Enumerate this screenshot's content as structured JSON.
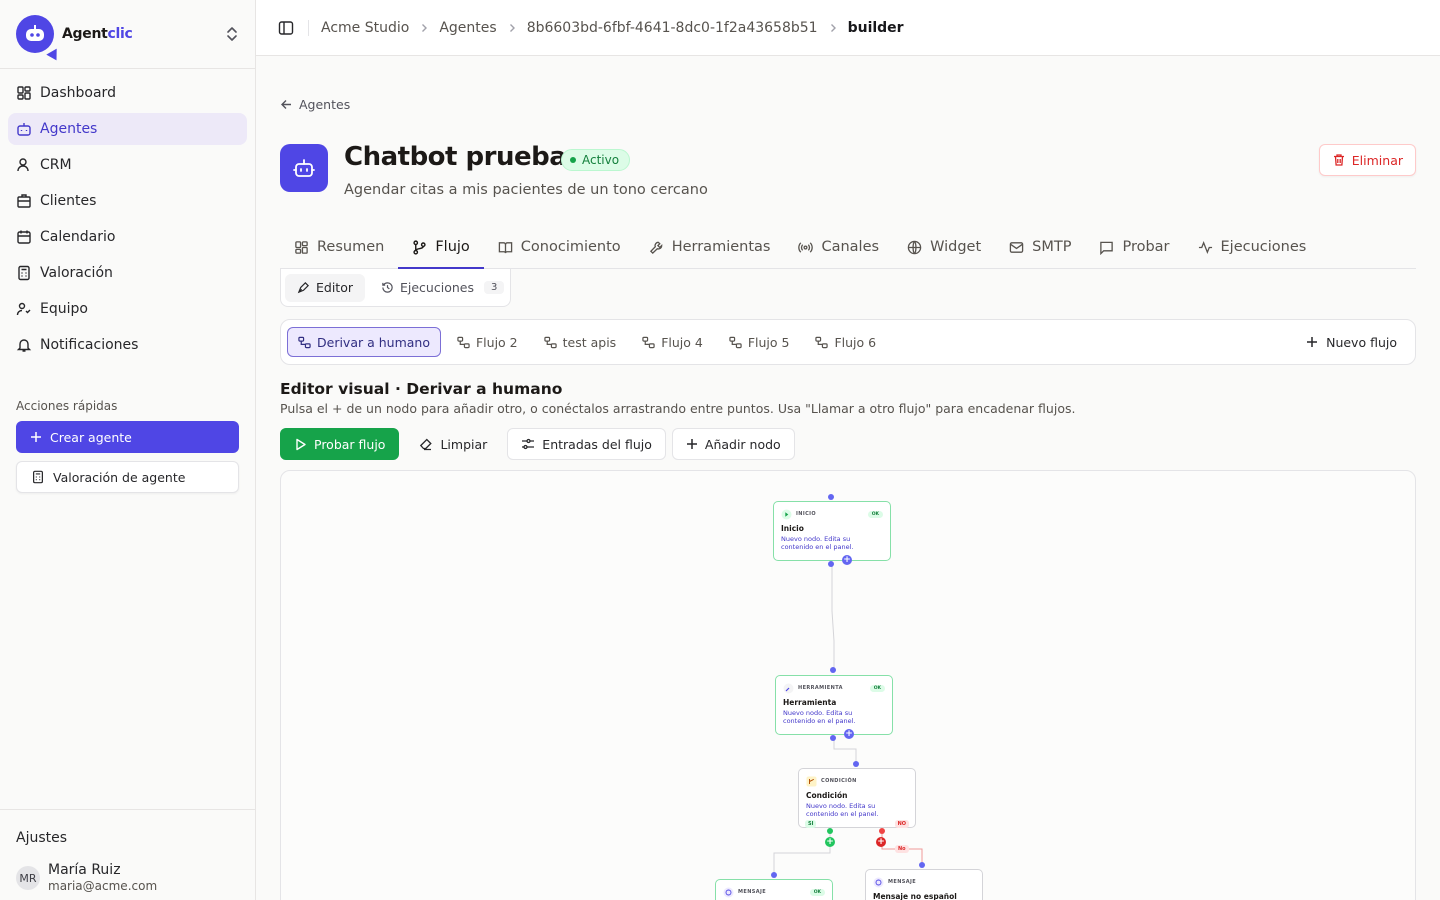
{
  "brand": {
    "name_main": "Agent",
    "name_accent": "clic"
  },
  "sidebar": {
    "items": [
      {
        "label": "Dashboard",
        "icon": "dashboard-icon"
      },
      {
        "label": "Agentes",
        "icon": "bot-icon",
        "active": true
      },
      {
        "label": "CRM",
        "icon": "users-icon"
      },
      {
        "label": "Clientes",
        "icon": "building-icon"
      },
      {
        "label": "Calendario",
        "icon": "calendar-icon"
      },
      {
        "label": "Valoración",
        "icon": "calculator-icon"
      },
      {
        "label": "Equipo",
        "icon": "team-icon"
      },
      {
        "label": "Notificaciones",
        "icon": "bell-icon"
      }
    ],
    "quick_actions_title": "Acciones rápidas",
    "quick_primary": "Crear agente",
    "quick_secondary": "Valoración de agente",
    "settings": "Ajustes",
    "user": {
      "initials": "MR",
      "name": "María Ruiz",
      "email": "maria@acme.com"
    }
  },
  "breadcrumb": [
    "Acme Studio",
    "Agentes",
    "8b6603bd-6fbf-4641-8dc0-1f2a43658b51",
    "builder"
  ],
  "back_label": "Agentes",
  "agent": {
    "title": "Chatbot pruebas",
    "status": "Activo",
    "subtitle": "Agendar citas a mis pacientes de un tono cercano",
    "delete": "Eliminar"
  },
  "tabs": [
    "Resumen",
    "Flujo",
    "Conocimiento",
    "Herramientas",
    "Canales",
    "Widget",
    "SMTP",
    "Probar",
    "Ejecuciones"
  ],
  "subtabs": {
    "editor": "Editor",
    "runs": "Ejecuciones",
    "runs_count": "3"
  },
  "flows": [
    "Derivar a humano",
    "Flujo 2",
    "test apis",
    "Flujo 4",
    "Flujo 5",
    "Flujo 6"
  ],
  "new_flow": "Nuevo flujo",
  "editor": {
    "title": "Editor visual · Derivar a humano",
    "hint": "Pulsa el + de un nodo para añadir otro, o conéctalos arrastrando entre puntos. Usa \"Llamar a otro flujo\" para encadenar flujos."
  },
  "actions": {
    "test": "Probar flujo",
    "clear": "Limpiar",
    "inputs": "Entradas del flujo",
    "add": "Añadir nodo"
  },
  "nodes": {
    "start": {
      "type": "INICIO",
      "status": "OK",
      "title": "Inicio",
      "desc": "Nuevo nodo. Edita su contenido en el panel."
    },
    "tool": {
      "type": "HERRAMIENTA",
      "status": "OK",
      "title": "Herramienta",
      "desc": "Nuevo nodo. Edita su contenido en el panel."
    },
    "cond": {
      "type": "CONDICIÓN",
      "title": "Condición",
      "desc": "Nuevo nodo. Edita su contenido en el panel.",
      "yes": "SI",
      "no": "NO",
      "edge_no": "No"
    },
    "msg1": {
      "type": "MENSAJE",
      "status": "OK"
    },
    "msg2": {
      "type": "MENSAJE",
      "title": "Mensaje no español"
    }
  },
  "colors": {
    "accent": "#4f46e5",
    "success": "#16a34a",
    "danger": "#dc2626"
  }
}
